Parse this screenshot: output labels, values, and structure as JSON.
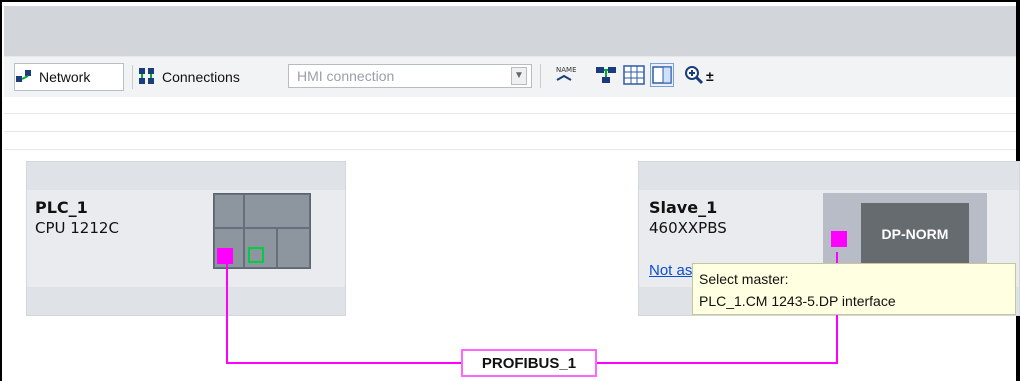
{
  "toolbar": {
    "network_label": "Network",
    "connections_label": "Connections",
    "connection_type": {
      "selected": "HMI connection"
    },
    "zoom_symbol": "±"
  },
  "devices": {
    "plc": {
      "name": "PLC_1",
      "type": "CPU 1212C"
    },
    "slave": {
      "name": "Slave_1",
      "type": "460XXPBS",
      "module_label": "DP-NORM",
      "link_text": "Not as"
    }
  },
  "tooltip": {
    "line1": "Select master:",
    "line2": "PLC_1.CM 1243-5.DP interface"
  },
  "network": {
    "bus_label": "PROFIBUS_1",
    "bus_color": "#ff00ff"
  }
}
